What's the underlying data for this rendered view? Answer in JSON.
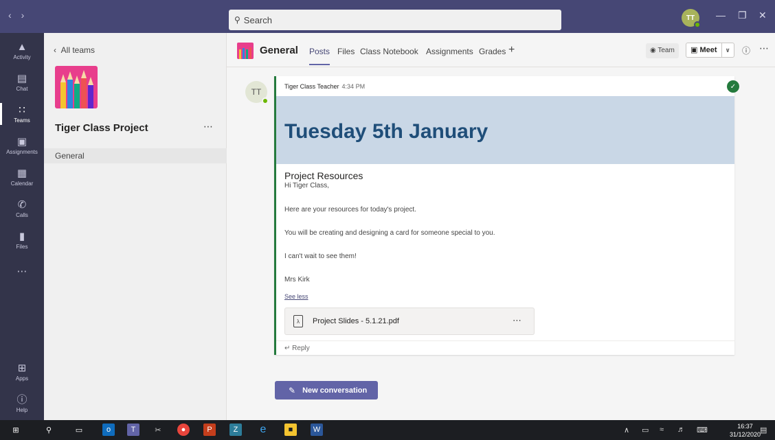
{
  "titlebar": {
    "search_placeholder": "Search",
    "avatar_initials": "TT"
  },
  "rail": {
    "items": [
      {
        "label": "Activity",
        "icon": "bell-icon"
      },
      {
        "label": "Chat",
        "icon": "chat-icon"
      },
      {
        "label": "Teams",
        "icon": "teams-icon",
        "active": true
      },
      {
        "label": "Assignments",
        "icon": "assignments-icon"
      },
      {
        "label": "Calendar",
        "icon": "calendar-icon"
      },
      {
        "label": "Calls",
        "icon": "phone-icon"
      },
      {
        "label": "Files",
        "icon": "file-icon"
      },
      {
        "label": "Apps",
        "icon": "apps-icon"
      },
      {
        "label": "Help",
        "icon": "help-icon"
      }
    ]
  },
  "team_pane": {
    "back_label": "All teams",
    "team_name": "Tiger Class Project",
    "channel": "General"
  },
  "header": {
    "channel_title": "General",
    "tabs": [
      {
        "label": "Posts",
        "active": true
      },
      {
        "label": "Files"
      },
      {
        "label": "Class Notebook"
      },
      {
        "label": "Assignments"
      },
      {
        "label": "Grades"
      }
    ],
    "team_label": "Team",
    "meet_label": "Meet"
  },
  "post": {
    "avatar_initials": "TT",
    "author": "Tiger Class Teacher",
    "time": "4:34 PM",
    "banner_title": "Tuesday 5th January",
    "subject": "Project Resources",
    "greeting": "Hi Tiger Class,",
    "paragraphs": [
      "Here are your resources for today's project.",
      "You will be creating and designing a card for someone special to you.",
      "I can't wait to see them!",
      "Mrs Kirk"
    ],
    "see_less": "See less",
    "attachment": "Project Slides - 5.1.21.pdf",
    "reply_label": "Reply"
  },
  "new_conversation_label": "New conversation",
  "taskbar": {
    "time": "16:37",
    "date": "31/12/2020"
  },
  "colors": {
    "titlebar": "#464775",
    "rail": "#33344a",
    "accent": "#6264a7",
    "post_border": "#247a3d",
    "banner": "#c9d7e6",
    "banner_text": "#1f4e79"
  }
}
